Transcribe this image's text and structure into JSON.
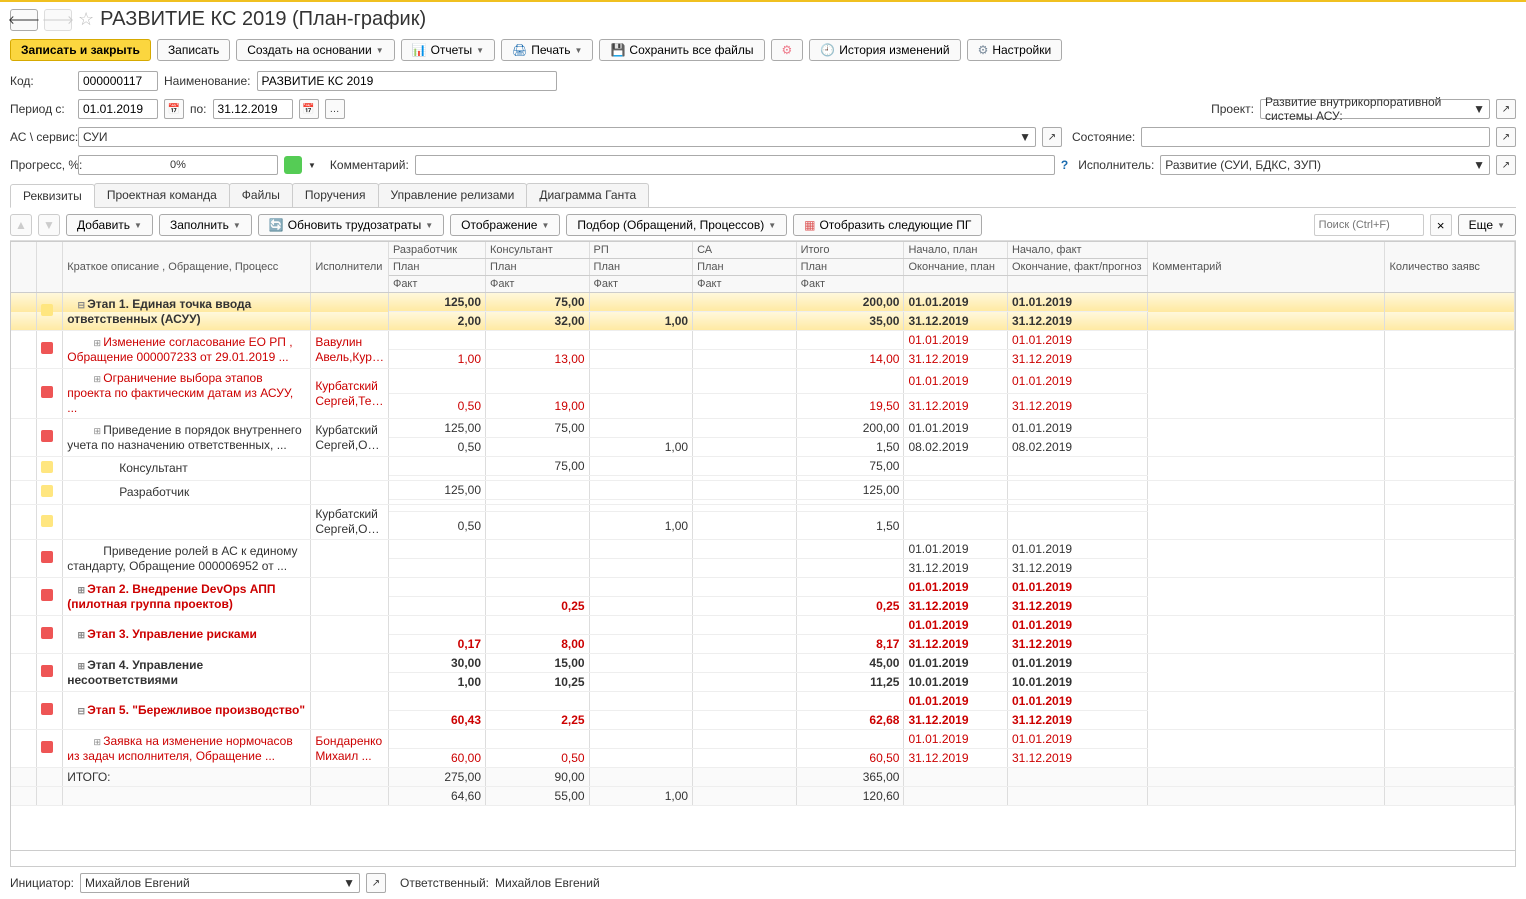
{
  "title": "РАЗВИТИЕ КС 2019 (План-график)",
  "toolbar": {
    "save_close": "Записать и закрыть",
    "save": "Записать",
    "create_based": "Создать на основании",
    "reports": "Отчеты",
    "print": "Печать",
    "save_all": "Сохранить все файлы",
    "history": "История изменений",
    "settings": "Настройки"
  },
  "form": {
    "code_lbl": "Код:",
    "code": "000000117",
    "name_lbl": "Наименование:",
    "name": "РАЗВИТИЕ КС 2019",
    "period_from_lbl": "Период с:",
    "period_from": "01.01.2019",
    "period_to_lbl": "по:",
    "period_to": "31.12.2019",
    "project_lbl": "Проект:",
    "project": "Развитие внутрикорпоративной системы АСУ:",
    "ac_lbl": "АС \\ сервис:",
    "ac": "СУИ",
    "state_lbl": "Состояние:",
    "state": "",
    "progress_lbl": "Прогресс, %:",
    "progress": "0%",
    "comment_lbl": "Комментарий:",
    "executor_lbl": "Исполнитель:",
    "executor": "Развитие (СУИ, БДКС, ЗУП)"
  },
  "tabs": [
    "Реквизиты",
    "Проектная команда",
    "Файлы",
    "Поручения",
    "Управление релизами",
    "Диаграмма Ганта"
  ],
  "subtoolbar": {
    "add": "Добавить",
    "fill": "Заполнить",
    "refresh": "Обновить трудозатраты",
    "display": "Отображение",
    "select": "Подбор (Обращений, Процессов)",
    "show_next": "Отобразить следующие ПГ",
    "search_ph": "Поиск (Ctrl+F)",
    "more": "Еще"
  },
  "grid": {
    "headers": {
      "desc": "Краткое описание , Обращение, Процесс",
      "exec": "Исполнители",
      "dev": "Разработчик",
      "cons": "Консультант",
      "rp": "РП",
      "sa": "СА",
      "total": "Итого",
      "start_plan": "Начало, план",
      "start_fact": "Начало, факт",
      "end_plan": "Окончание, план",
      "end_fact": "Окончание, факт/прогноз",
      "comment": "Комментарий",
      "qty": "Количество заявс",
      "plan": "План",
      "fact": "Факт"
    },
    "rows": [
      {
        "st": "y",
        "sel": true,
        "bold": true,
        "lv": 0,
        "tg": "−",
        "desc": "Этап 1. Единая точка ввода ответственных (АСУУ)",
        "ex": "",
        "dp": "125,00",
        "df": "2,00",
        "cp": "75,00",
        "cf": "32,00",
        "rp": "",
        "rf": "1,00",
        "sp": "",
        "sf": "",
        "tp": "200,00",
        "tf": "35,00",
        "sp1": "01.01.2019",
        "sf1": "01.01.2019",
        "ep": "31.12.2019",
        "ef": "31.12.2019"
      },
      {
        "st": "r",
        "red": true,
        "lv": 1,
        "tg": "+",
        "desc": "Изменение согласование ЕО РП , Обращение 000007233 от 29.01.2019 ...",
        "ex": "Вавулин Авель,Курба",
        "dp": "",
        "df": "1,00",
        "cp": "",
        "cf": "13,00",
        "rp": "",
        "rf": "",
        "sp": "",
        "sf": "",
        "tp": "",
        "tf": "14,00",
        "sp1": "01.01.2019",
        "sf1": "01.01.2019",
        "ep": "31.12.2019",
        "ef": "31.12.2019"
      },
      {
        "st": "r",
        "red": true,
        "lv": 1,
        "tg": "+",
        "desc": "Ограничение выбора этапов проекта по фактическим датам из АСУУ, ...",
        "ex": "Курбатский Сергей,Тере",
        "dp": "",
        "df": "0,50",
        "cp": "",
        "cf": "19,00",
        "rp": "",
        "rf": "",
        "sp": "",
        "sf": "",
        "tp": "",
        "tf": "19,50",
        "sp1": "01.01.2019",
        "sf1": "01.01.2019",
        "ep": "31.12.2019",
        "ef": "31.12.2019"
      },
      {
        "st": "r",
        "lv": 1,
        "tg": "+",
        "desc": "Приведение в порядок внутреннего учета по назначению ответственных, ...",
        "ex": "Курбатский Сергей,Орло",
        "dp": "125,00",
        "df": "0,50",
        "cp": "75,00",
        "cf": "",
        "rp": "",
        "rf": "1,00",
        "sp": "",
        "sf": "",
        "tp": "200,00",
        "tf": "1,50",
        "sp1": "01.01.2019",
        "sf1": "01.01.2019",
        "ep": "08.02.2019",
        "ef": "08.02.2019"
      },
      {
        "st": "y",
        "lv": 2,
        "tg": "",
        "desc": "Консультант",
        "ex": "",
        "dp": "",
        "df": "",
        "cp": "75,00",
        "cf": "",
        "rp": "",
        "rf": "",
        "sp": "",
        "sf": "",
        "tp": "75,00",
        "tf": "",
        "sp1": "",
        "sf1": "",
        "ep": "",
        "ef": ""
      },
      {
        "st": "y",
        "lv": 2,
        "tg": "",
        "desc": "Разработчик",
        "ex": "",
        "dp": "125,00",
        "df": "",
        "cp": "",
        "cf": "",
        "rp": "",
        "rf": "",
        "sp": "",
        "sf": "",
        "tp": "125,00",
        "tf": "",
        "sp1": "",
        "sf1": "",
        "ep": "",
        "ef": ""
      },
      {
        "st": "y",
        "lv": 2,
        "tg": "",
        "desc": "",
        "ex": "Курбатский Сергей,Орло",
        "dp": "",
        "df": "0,50",
        "cp": "",
        "cf": "",
        "rp": "",
        "rf": "1,00",
        "sp": "",
        "sf": "",
        "tp": "",
        "tf": "1,50",
        "sp1": "",
        "sf1": "",
        "ep": "",
        "ef": ""
      },
      {
        "st": "r",
        "lv": 1,
        "tg": "",
        "desc": "Приведение ролей в АС к единому стандарту, Обращение 000006952 от ...",
        "ex": "",
        "dp": "",
        "df": "",
        "cp": "",
        "cf": "",
        "rp": "",
        "rf": "",
        "sp": "",
        "sf": "",
        "tp": "",
        "tf": "",
        "sp1": "01.01.2019",
        "sf1": "01.01.2019",
        "ep": "31.12.2019",
        "ef": "31.12.2019"
      },
      {
        "st": "r",
        "red": true,
        "bold": true,
        "lv": 0,
        "tg": "+",
        "desc": "Этап 2. Внедрение DevOps АПП (пилотная группа проектов)",
        "ex": "",
        "dp": "",
        "df": "",
        "cp": "",
        "cf": "0,25",
        "rp": "",
        "rf": "",
        "sp": "",
        "sf": "",
        "tp": "",
        "tf": "0,25",
        "sp1": "01.01.2019",
        "sf1": "01.01.2019",
        "ep": "31.12.2019",
        "ef": "31.12.2019"
      },
      {
        "st": "r",
        "red": true,
        "bold": true,
        "lv": 0,
        "tg": "+",
        "desc": "Этап 3. Управление рисками",
        "ex": "",
        "dp": "",
        "df": "0,17",
        "cp": "",
        "cf": "8,00",
        "rp": "",
        "rf": "",
        "sp": "",
        "sf": "",
        "tp": "",
        "tf": "8,17",
        "sp1": "01.01.2019",
        "sf1": "01.01.2019",
        "ep": "31.12.2019",
        "ef": "31.12.2019"
      },
      {
        "st": "r",
        "bold": true,
        "lv": 0,
        "tg": "+",
        "desc": "Этап 4. Управление несоответствиями",
        "ex": "",
        "dp": "30,00",
        "df": "1,00",
        "cp": "15,00",
        "cf": "10,25",
        "rp": "",
        "rf": "",
        "sp": "",
        "sf": "",
        "tp": "45,00",
        "tf": "11,25",
        "sp1": "01.01.2019",
        "sf1": "01.01.2019",
        "ep": "10.01.2019",
        "ef": "10.01.2019"
      },
      {
        "st": "r",
        "red": true,
        "bold": true,
        "lv": 0,
        "tg": "−",
        "desc": "Этап 5. \"Бережливое производство\"",
        "ex": "",
        "dp": "",
        "df": "60,43",
        "cp": "",
        "cf": "2,25",
        "rp": "",
        "rf": "",
        "sp": "",
        "sf": "",
        "tp": "",
        "tf": "62,68",
        "sp1": "01.01.2019",
        "sf1": "01.01.2019",
        "ep": "31.12.2019",
        "ef": "31.12.2019"
      },
      {
        "st": "r",
        "red": true,
        "lv": 1,
        "tg": "+",
        "desc": "Заявка на изменение нормочасов из задач исполнителя, Обращение ...",
        "ex": "Бондаренко Михаил ...",
        "dp": "",
        "df": "60,00",
        "cp": "",
        "cf": "0,50",
        "rp": "",
        "rf": "",
        "sp": "",
        "sf": "",
        "tp": "",
        "tf": "60,50",
        "sp1": "01.01.2019",
        "sf1": "01.01.2019",
        "ep": "31.12.2019",
        "ef": "31.12.2019"
      }
    ],
    "footer": {
      "label": "ИТОГО:",
      "dp": "275,00",
      "df": "64,60",
      "cp": "90,00",
      "cf": "55,00",
      "rp": "",
      "rf": "1,00",
      "sp": "",
      "sf": "",
      "tp": "365,00",
      "tf": "120,60"
    }
  },
  "bottom": {
    "init_lbl": "Инициатор:",
    "init": "Михайлов Евгений",
    "resp_lbl": "Ответственный:",
    "resp": "Михайлов Евгений"
  }
}
